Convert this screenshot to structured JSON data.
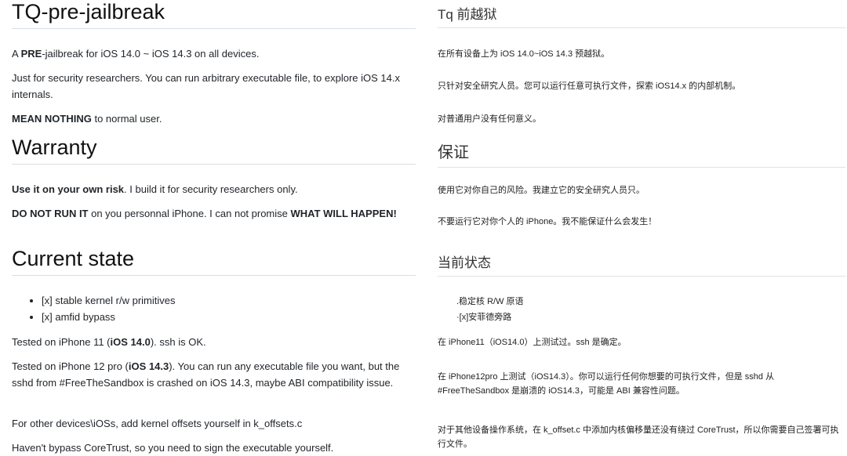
{
  "english": {
    "title": "TQ-pre-jailbreak",
    "intro": {
      "p1_pre": "A ",
      "p1_bold": "PRE",
      "p1_post": "-jailbreak for iOS 14.0 ~ iOS 14.3 on all devices.",
      "p2": "Just for security researchers. You can run arbitrary executable file, to explore iOS 14.x internals.",
      "p3_bold": "MEAN NOTHING",
      "p3_post": " to normal user."
    },
    "warranty": {
      "heading": "Warranty",
      "p1_bold": "Use it on your own risk",
      "p1_post": ". I build it for security researchers only.",
      "p2_bold1": "DO NOT RUN IT",
      "p2_mid": " on you personnal iPhone. I can not promise ",
      "p2_bold2": "WHAT WILL HAPPEN!"
    },
    "current_state": {
      "heading": "Current state",
      "bullets": [
        "[x] stable kernel r/w primitives",
        "[x] amfid bypass"
      ],
      "t1_pre": "Tested on iPhone 11 (",
      "t1_bold": "iOS 14.0",
      "t1_post": "). ssh is OK.",
      "t2_pre": "Tested on iPhone 12 pro (",
      "t2_bold": "iOS 14.3",
      "t2_post": "). You can run any executable file you want, but the sshd from #FreeTheSandbox is crashed on iOS 14.3, maybe ABI compatibility issue.",
      "t3": "For other devices\\iOSs, add kernel offsets yourself in k_offsets.c",
      "t4": "Haven't bypass CoreTrust, so you need to sign the executable yourself."
    }
  },
  "chinese": {
    "title": "Tq 前越狱",
    "p1": "在所有设备上为 iOS 14.0~iOS 14.3 预越狱。",
    "p2": "只针对安全研究人员。您可以运行任意可执行文件，探索 iOS14.x 的内部机制。",
    "p3": "对普通用户没有任何意义。",
    "warranty_heading": "保证",
    "w1": "使用它对你自己的风险。我建立它的安全研究人员只。",
    "w2": "不要运行它对你个人的 iPhone。我不能保证什么会发生！",
    "state_heading": "当前状态",
    "bullets": [
      ".稳定核 R/W 原语",
      "·[x]安菲德旁路"
    ],
    "s1": "在 iPhone11（iOS14.0）上测试过。ssh 是确定。",
    "s2": "在 iPhone12pro 上测试（iOS14.3）。你可以运行任何你想要的可执行文件，但是 sshd 从 #FreeTheSandbox 是崩溃的 iOS14.3，可能是 ABI 兼容性问题。",
    "s3": "对于其他设备操作系统，在 k_offset.c 中添加内核偏移量还没有绕过 CoreTrust，所以你需要自己签署可执行文件。"
  }
}
